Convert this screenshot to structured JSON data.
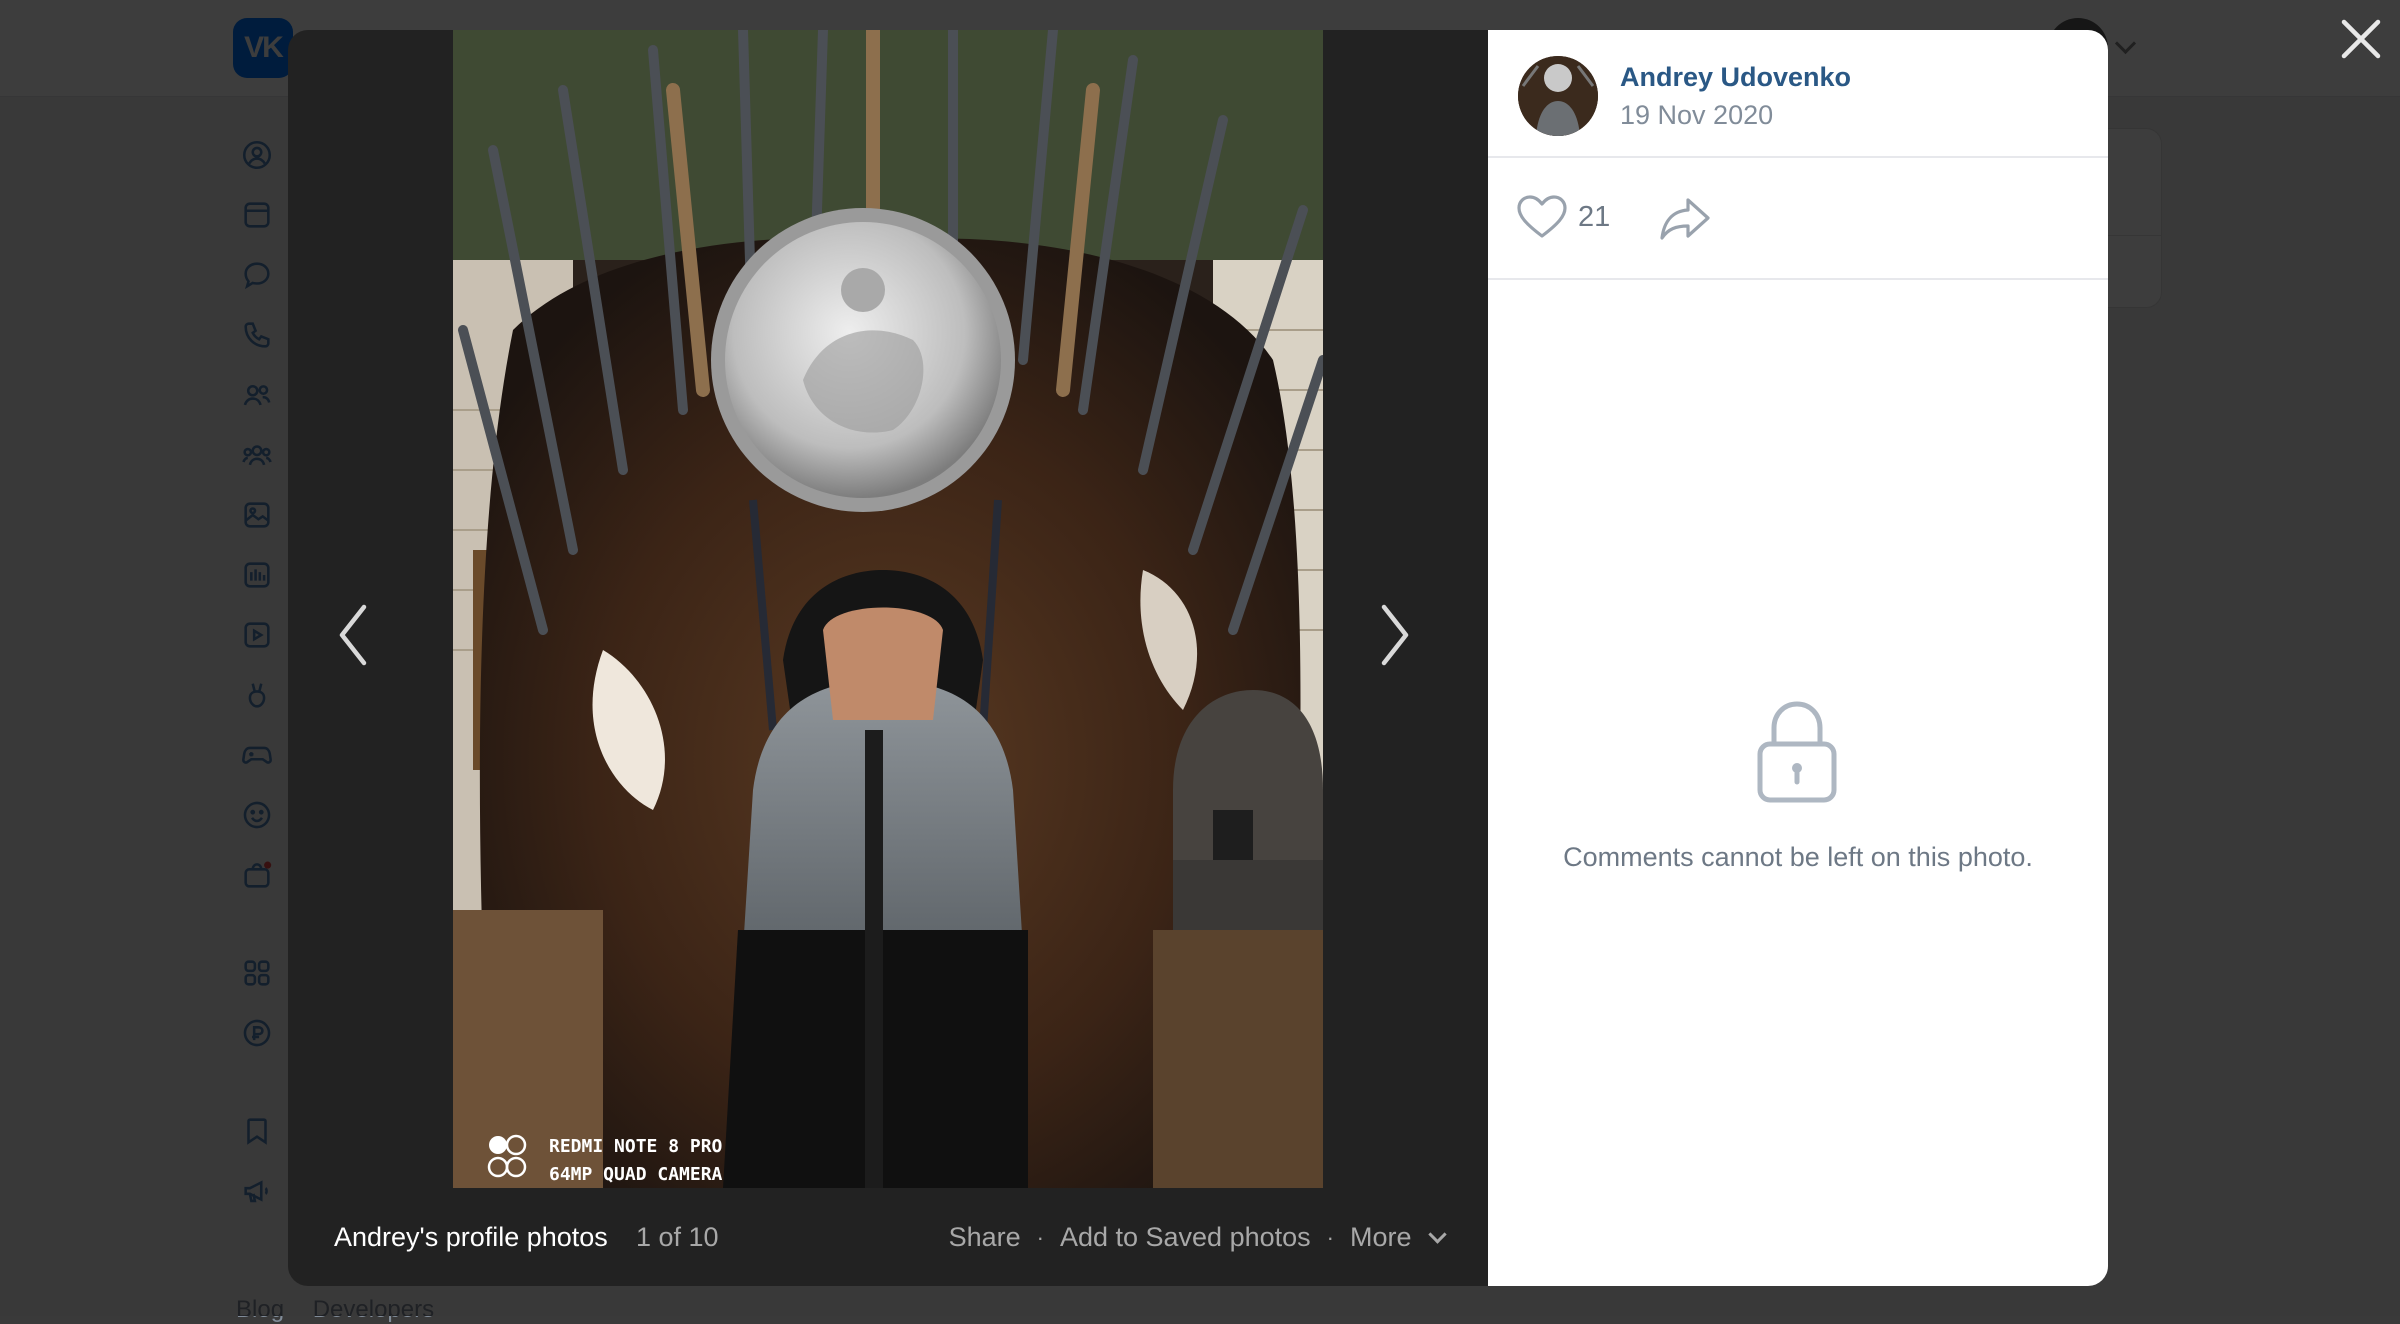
{
  "viewer": {
    "album_title": "Andrey's profile photos",
    "counter": "1 of 10",
    "actions": {
      "share": "Share",
      "save": "Add to Saved photos",
      "more": "More"
    },
    "photo": {
      "watermark_line1": "REDMI NOTE 8 PRO",
      "watermark_line2": "64MP QUAD CAMERA"
    }
  },
  "post": {
    "author_name": "Andrey Udovenko",
    "date": "19 Nov 2020",
    "likes": "21",
    "comments_message": "Comments cannot be left on this photo."
  },
  "background": {
    "footer_links": [
      "Blog",
      "Developers"
    ]
  },
  "colors": {
    "brand": "#0077ff",
    "link": "#2a5885",
    "muted": "#818c99"
  }
}
